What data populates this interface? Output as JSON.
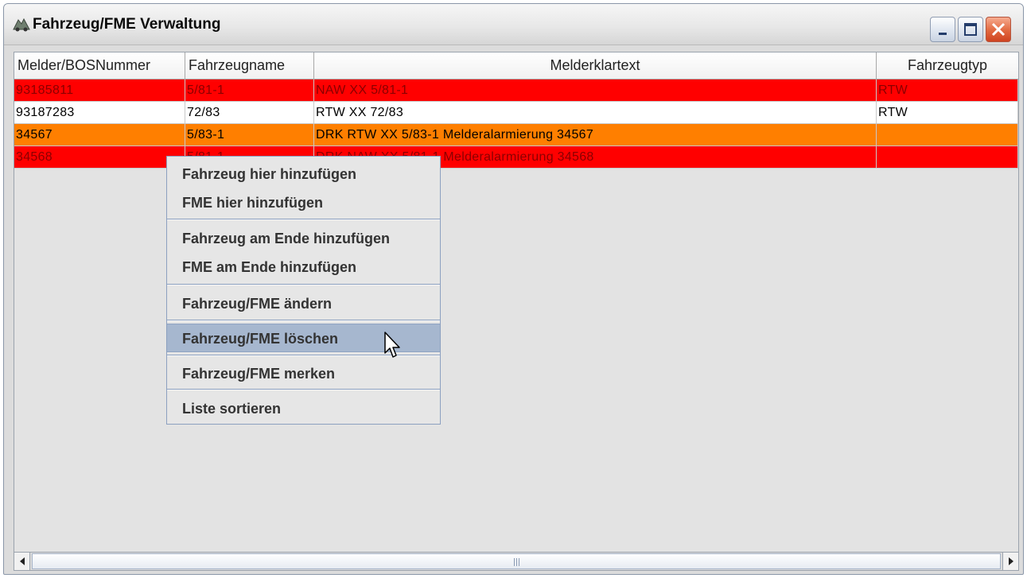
{
  "window": {
    "title": "Fahrzeug/FME Verwaltung"
  },
  "icons": {
    "app": "vehicle-app-icon",
    "minimize": "minimize-icon",
    "maximize": "maximize-icon",
    "close": "close-icon",
    "scroll_left": "arrow-left-icon",
    "scroll_right": "arrow-right-icon",
    "cursor": "mouse-pointer-icon"
  },
  "table": {
    "columns": [
      "Melder/BOSNummer",
      "Fahrzeugname",
      "Melderklartext",
      "Fahrzeugtyp"
    ],
    "rows": [
      {
        "cells": [
          "93185811",
          "5/81-1",
          "NAW XX 5/81-1",
          "RTW"
        ],
        "bg": "#ff0000",
        "fg": "#8a0000"
      },
      {
        "cells": [
          "93187283",
          "72/83",
          "RTW XX 72/83",
          "RTW"
        ],
        "bg": "#ffffff",
        "fg": "#000000"
      },
      {
        "cells": [
          "34567",
          "5/83-1",
          "DRK RTW XX 5/83-1 Melderalarmierung 34567",
          ""
        ],
        "bg": "#ff7f00",
        "fg": "#000000"
      },
      {
        "cells": [
          "34568",
          "5/81-1",
          "DRK NAW XX 5/81-1 Melderalarmierung 34568",
          ""
        ],
        "bg": "#ff0000",
        "fg": "#8a0000"
      }
    ]
  },
  "context_menu": {
    "items": [
      "Fahrzeug hier hinzufügen",
      "FME hier hinzufügen",
      "Fahrzeug am Ende hinzufügen",
      "FME am Ende hinzufügen",
      "Fahrzeug/FME ändern",
      "Fahrzeug/FME löschen",
      "Fahrzeug/FME merken",
      "Liste sortieren"
    ],
    "highlighted_index": 5
  },
  "colors": {
    "row_red": "#ff0000",
    "row_orange": "#ff7f00",
    "menu_highlight": "#a6b7cf",
    "close_button": "#e2683f"
  }
}
